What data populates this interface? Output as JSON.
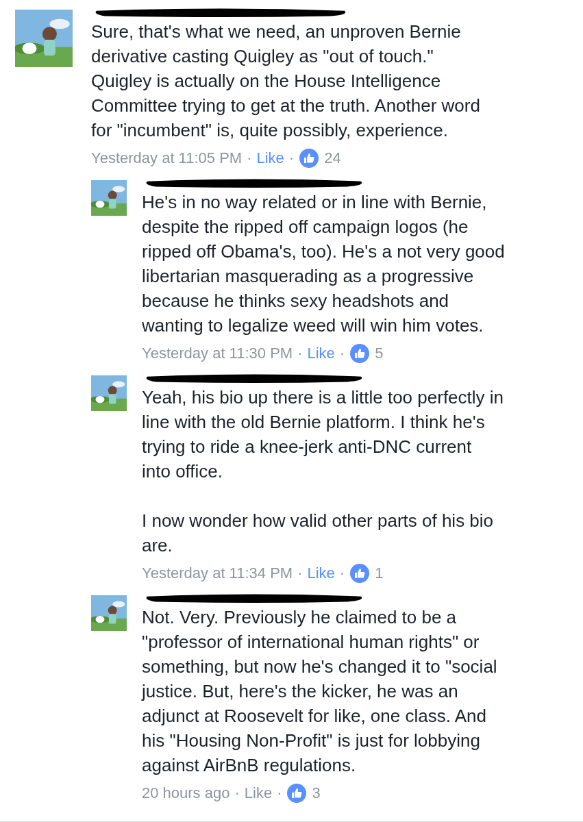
{
  "comments": [
    {
      "kind": "comment",
      "text": "Sure, that's what we need, an unproven Bernie\nderivative casting Quigley as \"out of touch.\"\nQuigley is actually on the House Intelligence\nCommittee trying to get at the truth.  Another word\nfor \"incumbent\" is, quite possibly, experience.",
      "time": "Yesterday at 11:05 PM",
      "separator": "·",
      "like_label": "Like",
      "liked": true,
      "likes": "24"
    },
    {
      "kind": "reply",
      "text": "He's in no way related or in line with Bernie,\ndespite the ripped off campaign logos (he\nripped off Obama's, too). He's a not very good\nlibertarian masquerading as a progressive\nbecause he thinks sexy headshots and\nwanting to legalize weed will win him votes.",
      "time": "Yesterday at 11:30 PM",
      "separator": "·",
      "like_label": "Like",
      "liked": true,
      "likes": "5"
    },
    {
      "kind": "reply",
      "text": "Yeah, his bio up there is a little too perfectly in\nline with the old Bernie platform. I think he's\ntrying to ride a knee-jerk anti-DNC current\ninto office.\n\nI now wonder how valid other parts of his bio\nare.",
      "time": "Yesterday at 11:34 PM",
      "separator": "·",
      "like_label": "Like",
      "liked": true,
      "likes": "1"
    },
    {
      "kind": "reply",
      "text": "Not. Very. Previously he claimed to be a\n\"professor of international human rights\" or\nsomething, but now he's changed it to \"social\njustice. But, here's the kicker, he was an\nadjunct at Roosevelt for like, one class. And\nhis \"Housing Non-Profit\" is just for lobbying\nagainst AirBnB regulations.",
      "time": "20 hours ago",
      "separator": "·",
      "like_label": "Like",
      "liked": false,
      "likes": "3"
    }
  ]
}
